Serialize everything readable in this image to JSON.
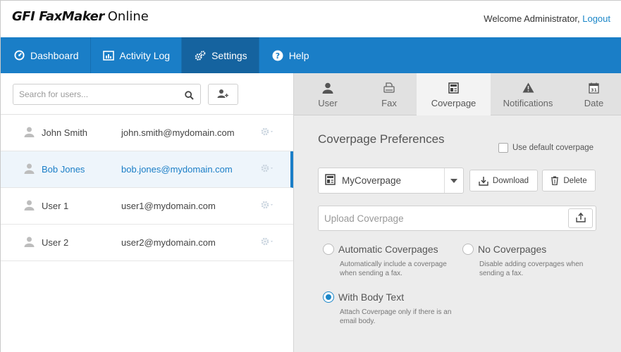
{
  "header": {
    "logo_gfi": "GFI",
    "logo_faxmaker": "FaxMaker",
    "logo_online": "Online",
    "welcome_text": "Welcome Administrator,",
    "logout_label": "Logout"
  },
  "nav": {
    "items": [
      {
        "label": "Dashboard",
        "icon": "dashboard-icon"
      },
      {
        "label": "Activity Log",
        "icon": "activity-log-icon"
      },
      {
        "label": "Settings",
        "icon": "gears-icon",
        "active": true
      },
      {
        "label": "Help",
        "icon": "help-icon"
      }
    ]
  },
  "search": {
    "placeholder": "Search for users..."
  },
  "users": [
    {
      "name": "John Smith",
      "email": "john.smith@mydomain.com"
    },
    {
      "name": "Bob Jones",
      "email": "bob.jones@mydomain.com",
      "selected": true
    },
    {
      "name": "User 1",
      "email": "user1@mydomain.com"
    },
    {
      "name": "User 2",
      "email": "user2@mydomain.com"
    }
  ],
  "tabs": [
    {
      "label": "User",
      "icon": "user-icon"
    },
    {
      "label": "Fax",
      "icon": "fax-icon"
    },
    {
      "label": "Coverpage",
      "icon": "coverpage-icon",
      "active": true
    },
    {
      "label": "Notifications",
      "icon": "warning-icon"
    },
    {
      "label": "Date",
      "icon": "calendar-icon"
    }
  ],
  "calendar_day": "31",
  "coverpage": {
    "title": "Coverpage Preferences",
    "use_default_label": "Use default coverpage",
    "selected_coverpage": "MyCoverpage",
    "download_label": "Download",
    "delete_label": "Delete",
    "upload_placeholder": "Upload Coverpage",
    "options": {
      "automatic": {
        "label": "Automatic Coverpages",
        "description": "Automatically include a coverpage when sending a fax."
      },
      "none": {
        "label": "No Coverpages",
        "description": "Disable adding coverpages when sending a fax."
      },
      "body": {
        "label": "With Body Text",
        "description": "Attach Coverpage only if there is an email body.",
        "checked": true
      }
    }
  },
  "colors": {
    "brand_blue": "#1a7ec7",
    "nav_active": "#15639f",
    "link": "#1a86c8"
  }
}
